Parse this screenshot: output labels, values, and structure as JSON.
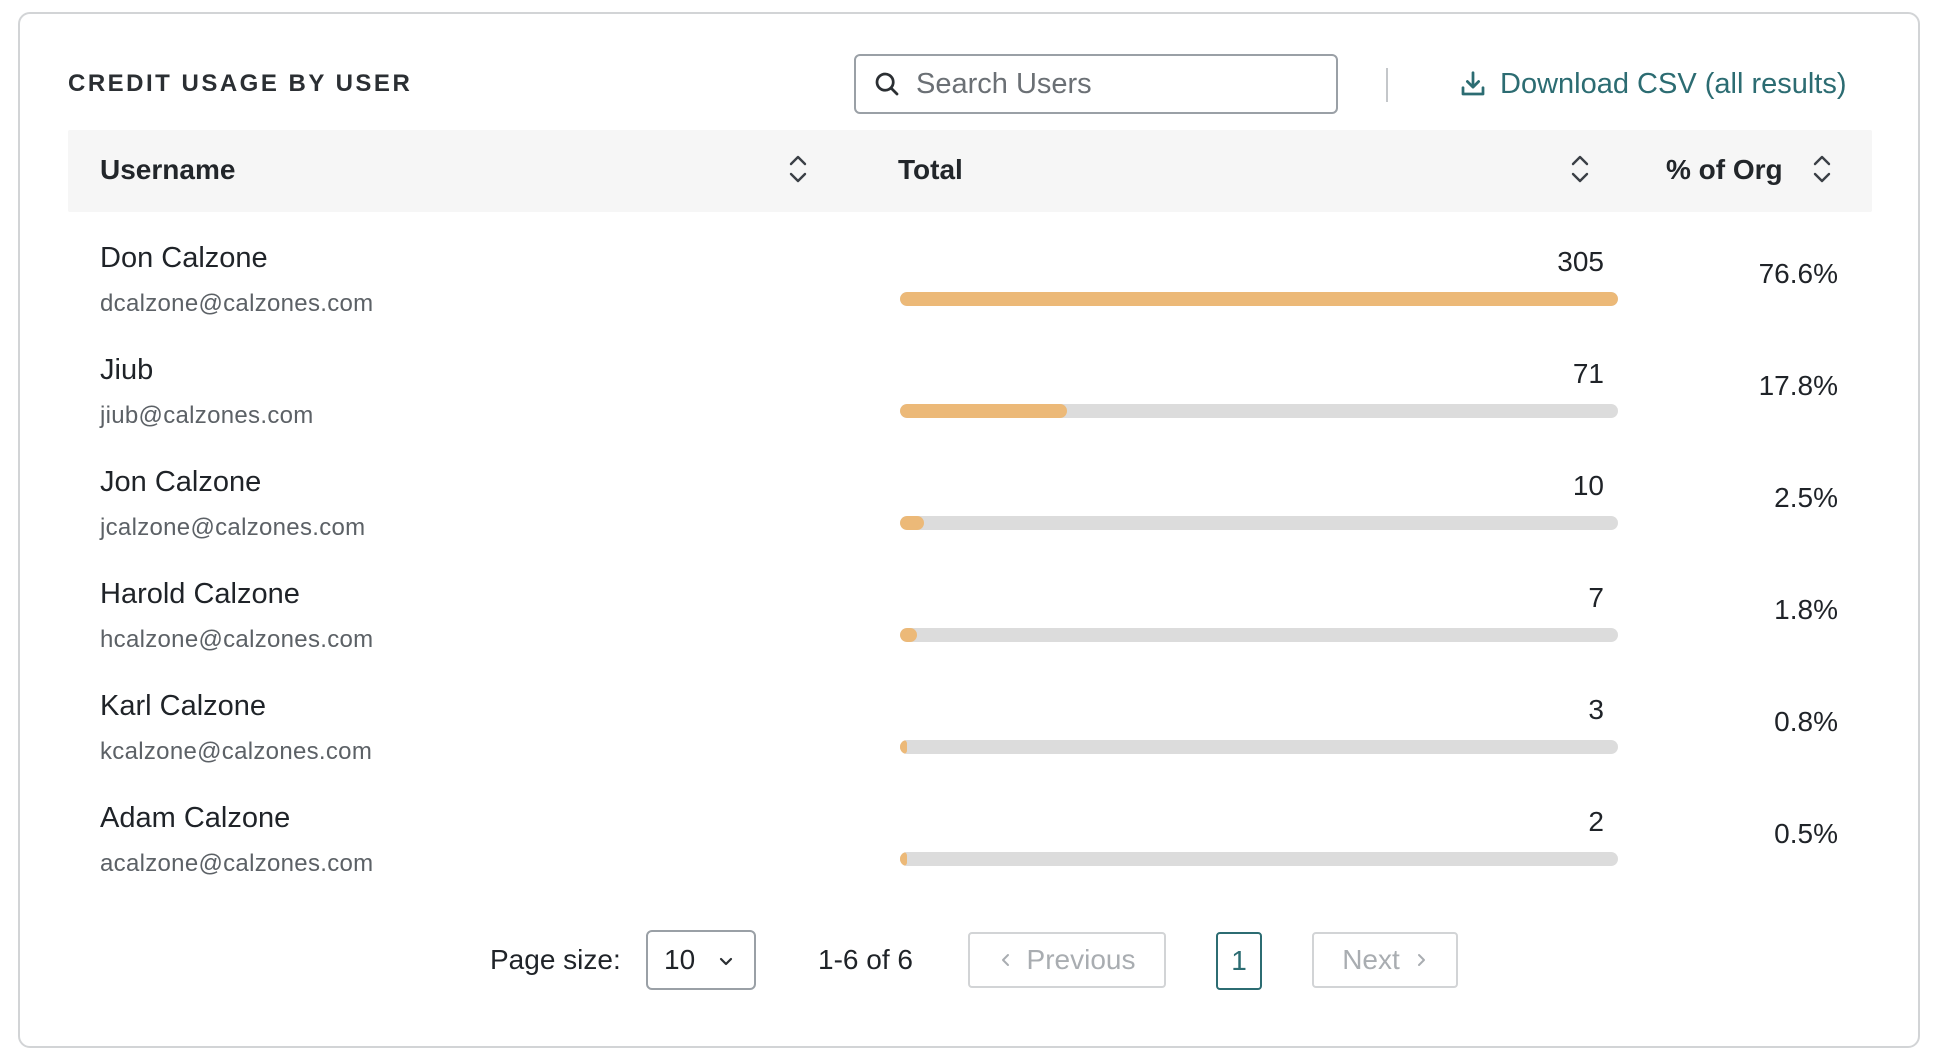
{
  "header": {
    "title": "CREDIT USAGE BY USER",
    "search_placeholder": "Search Users",
    "download_label": "Download CSV (all results)"
  },
  "columns": {
    "username": "Username",
    "total": "Total",
    "percent": "% of Org"
  },
  "rows": [
    {
      "name": "Don Calzone",
      "email": "dcalzone@calzones.com",
      "total": "305",
      "percent": "76.6%",
      "bar_fraction": 1.0
    },
    {
      "name": "Jiub",
      "email": "jiub@calzones.com",
      "total": "71",
      "percent": "17.8%",
      "bar_fraction": 0.233
    },
    {
      "name": "Jon Calzone",
      "email": "jcalzone@calzones.com",
      "total": "10",
      "percent": "2.5%",
      "bar_fraction": 0.033
    },
    {
      "name": "Harold Calzone",
      "email": "hcalzone@calzones.com",
      "total": "7",
      "percent": "1.8%",
      "bar_fraction": 0.023
    },
    {
      "name": "Karl Calzone",
      "email": "kcalzone@calzones.com",
      "total": "3",
      "percent": "0.8%",
      "bar_fraction": 0.01
    },
    {
      "name": "Adam Calzone",
      "email": "acalzone@calzones.com",
      "total": "2",
      "percent": "0.5%",
      "bar_fraction": 0.007
    }
  ],
  "pagination": {
    "page_size_label": "Page size:",
    "page_size_value": "10",
    "range_text": "1-6 of 6",
    "previous_label": "Previous",
    "current_page": "1",
    "next_label": "Next"
  },
  "colors": {
    "accent": "#2c6c72",
    "bar_fill": "#ecb978",
    "bar_track": "#dcdcdc",
    "header_bg": "#f6f6f6"
  },
  "icons": {
    "search": "search-icon",
    "download": "download-icon",
    "sort": "sort-icon",
    "chevron_down": "chevron-down-icon",
    "chevron_left": "chevron-left-icon",
    "chevron_right": "chevron-right-icon"
  }
}
